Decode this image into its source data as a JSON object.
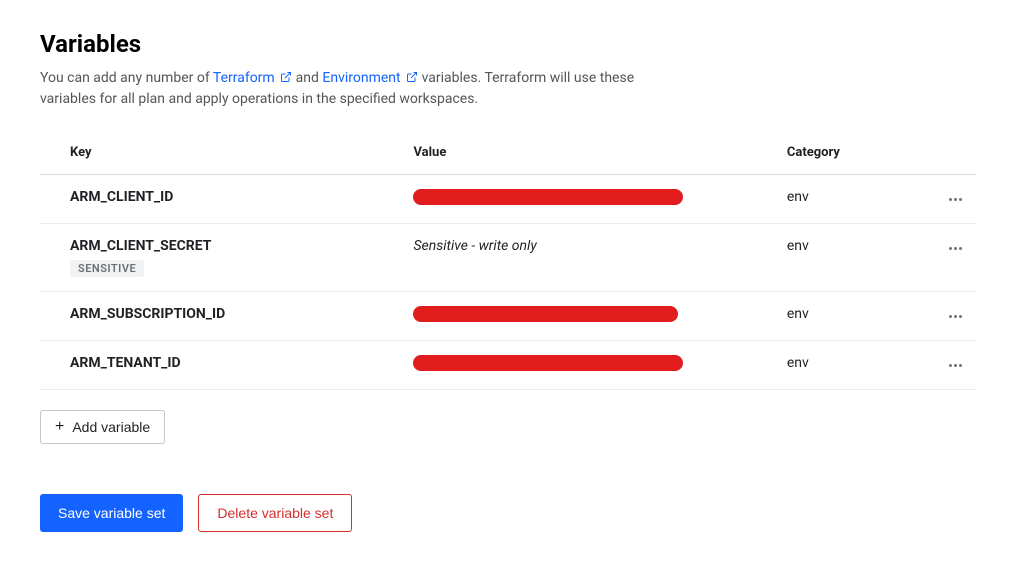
{
  "title": "Variables",
  "description_parts": {
    "prefix": "You can add any number of ",
    "link_terraform": "Terraform",
    "and": " and ",
    "link_environment": "Environment",
    "suffix": " variables. Terraform will use these variables for all plan and apply operations in the specified workspaces."
  },
  "table": {
    "headers": {
      "key": "Key",
      "value": "Value",
      "category": "Category"
    },
    "rows": [
      {
        "key": "ARM_CLIENT_ID",
        "value_redacted": true,
        "category": "env",
        "sensitive": false
      },
      {
        "key": "ARM_CLIENT_SECRET",
        "value_sensitive_text": "Sensitive - write only",
        "category": "env",
        "sensitive": true,
        "sensitive_badge": "SENSITIVE"
      },
      {
        "key": "ARM_SUBSCRIPTION_ID",
        "value_redacted": true,
        "category": "env",
        "sensitive": false
      },
      {
        "key": "ARM_TENANT_ID",
        "value_redacted": true,
        "category": "env",
        "sensitive": false
      }
    ]
  },
  "buttons": {
    "add_variable": "Add variable",
    "save_set": "Save variable set",
    "delete_set": "Delete variable set"
  }
}
